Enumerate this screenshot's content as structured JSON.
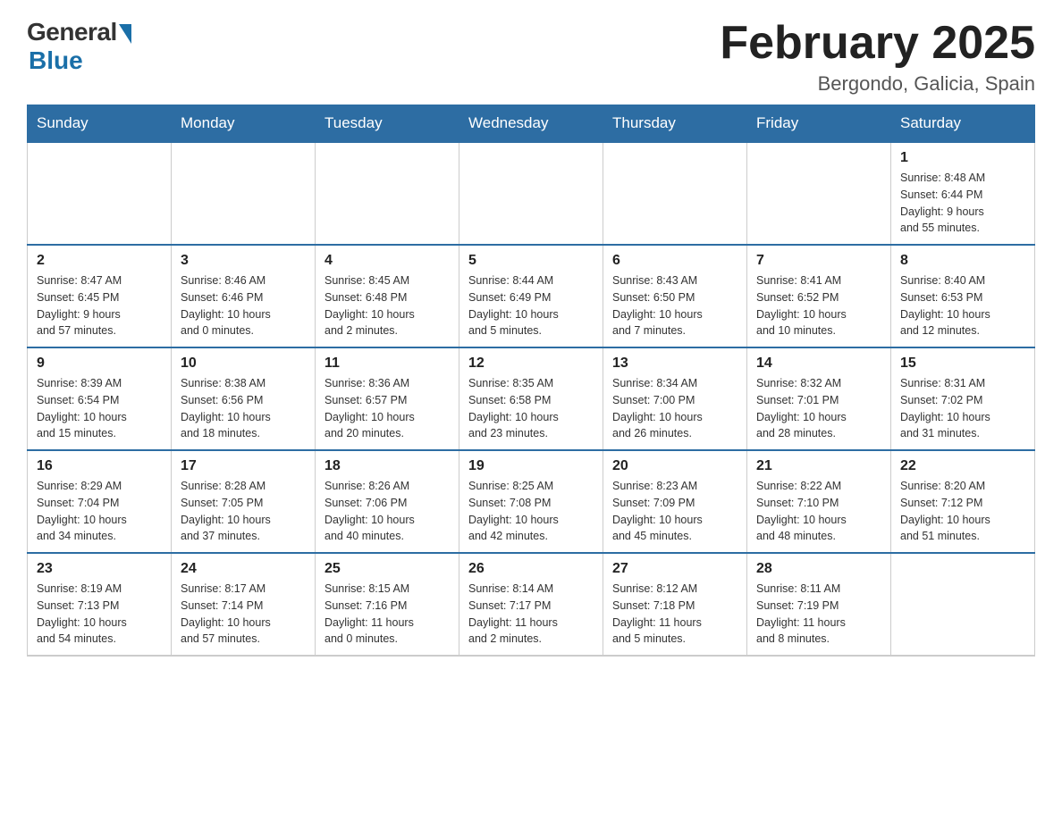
{
  "header": {
    "logo_general": "General",
    "logo_blue": "Blue",
    "month_title": "February 2025",
    "location": "Bergondo, Galicia, Spain"
  },
  "days_of_week": [
    "Sunday",
    "Monday",
    "Tuesday",
    "Wednesday",
    "Thursday",
    "Friday",
    "Saturday"
  ],
  "weeks": [
    [
      {
        "day": "",
        "info": ""
      },
      {
        "day": "",
        "info": ""
      },
      {
        "day": "",
        "info": ""
      },
      {
        "day": "",
        "info": ""
      },
      {
        "day": "",
        "info": ""
      },
      {
        "day": "",
        "info": ""
      },
      {
        "day": "1",
        "info": "Sunrise: 8:48 AM\nSunset: 6:44 PM\nDaylight: 9 hours\nand 55 minutes."
      }
    ],
    [
      {
        "day": "2",
        "info": "Sunrise: 8:47 AM\nSunset: 6:45 PM\nDaylight: 9 hours\nand 57 minutes."
      },
      {
        "day": "3",
        "info": "Sunrise: 8:46 AM\nSunset: 6:46 PM\nDaylight: 10 hours\nand 0 minutes."
      },
      {
        "day": "4",
        "info": "Sunrise: 8:45 AM\nSunset: 6:48 PM\nDaylight: 10 hours\nand 2 minutes."
      },
      {
        "day": "5",
        "info": "Sunrise: 8:44 AM\nSunset: 6:49 PM\nDaylight: 10 hours\nand 5 minutes."
      },
      {
        "day": "6",
        "info": "Sunrise: 8:43 AM\nSunset: 6:50 PM\nDaylight: 10 hours\nand 7 minutes."
      },
      {
        "day": "7",
        "info": "Sunrise: 8:41 AM\nSunset: 6:52 PM\nDaylight: 10 hours\nand 10 minutes."
      },
      {
        "day": "8",
        "info": "Sunrise: 8:40 AM\nSunset: 6:53 PM\nDaylight: 10 hours\nand 12 minutes."
      }
    ],
    [
      {
        "day": "9",
        "info": "Sunrise: 8:39 AM\nSunset: 6:54 PM\nDaylight: 10 hours\nand 15 minutes."
      },
      {
        "day": "10",
        "info": "Sunrise: 8:38 AM\nSunset: 6:56 PM\nDaylight: 10 hours\nand 18 minutes."
      },
      {
        "day": "11",
        "info": "Sunrise: 8:36 AM\nSunset: 6:57 PM\nDaylight: 10 hours\nand 20 minutes."
      },
      {
        "day": "12",
        "info": "Sunrise: 8:35 AM\nSunset: 6:58 PM\nDaylight: 10 hours\nand 23 minutes."
      },
      {
        "day": "13",
        "info": "Sunrise: 8:34 AM\nSunset: 7:00 PM\nDaylight: 10 hours\nand 26 minutes."
      },
      {
        "day": "14",
        "info": "Sunrise: 8:32 AM\nSunset: 7:01 PM\nDaylight: 10 hours\nand 28 minutes."
      },
      {
        "day": "15",
        "info": "Sunrise: 8:31 AM\nSunset: 7:02 PM\nDaylight: 10 hours\nand 31 minutes."
      }
    ],
    [
      {
        "day": "16",
        "info": "Sunrise: 8:29 AM\nSunset: 7:04 PM\nDaylight: 10 hours\nand 34 minutes."
      },
      {
        "day": "17",
        "info": "Sunrise: 8:28 AM\nSunset: 7:05 PM\nDaylight: 10 hours\nand 37 minutes."
      },
      {
        "day": "18",
        "info": "Sunrise: 8:26 AM\nSunset: 7:06 PM\nDaylight: 10 hours\nand 40 minutes."
      },
      {
        "day": "19",
        "info": "Sunrise: 8:25 AM\nSunset: 7:08 PM\nDaylight: 10 hours\nand 42 minutes."
      },
      {
        "day": "20",
        "info": "Sunrise: 8:23 AM\nSunset: 7:09 PM\nDaylight: 10 hours\nand 45 minutes."
      },
      {
        "day": "21",
        "info": "Sunrise: 8:22 AM\nSunset: 7:10 PM\nDaylight: 10 hours\nand 48 minutes."
      },
      {
        "day": "22",
        "info": "Sunrise: 8:20 AM\nSunset: 7:12 PM\nDaylight: 10 hours\nand 51 minutes."
      }
    ],
    [
      {
        "day": "23",
        "info": "Sunrise: 8:19 AM\nSunset: 7:13 PM\nDaylight: 10 hours\nand 54 minutes."
      },
      {
        "day": "24",
        "info": "Sunrise: 8:17 AM\nSunset: 7:14 PM\nDaylight: 10 hours\nand 57 minutes."
      },
      {
        "day": "25",
        "info": "Sunrise: 8:15 AM\nSunset: 7:16 PM\nDaylight: 11 hours\nand 0 minutes."
      },
      {
        "day": "26",
        "info": "Sunrise: 8:14 AM\nSunset: 7:17 PM\nDaylight: 11 hours\nand 2 minutes."
      },
      {
        "day": "27",
        "info": "Sunrise: 8:12 AM\nSunset: 7:18 PM\nDaylight: 11 hours\nand 5 minutes."
      },
      {
        "day": "28",
        "info": "Sunrise: 8:11 AM\nSunset: 7:19 PM\nDaylight: 11 hours\nand 8 minutes."
      },
      {
        "day": "",
        "info": ""
      }
    ]
  ]
}
